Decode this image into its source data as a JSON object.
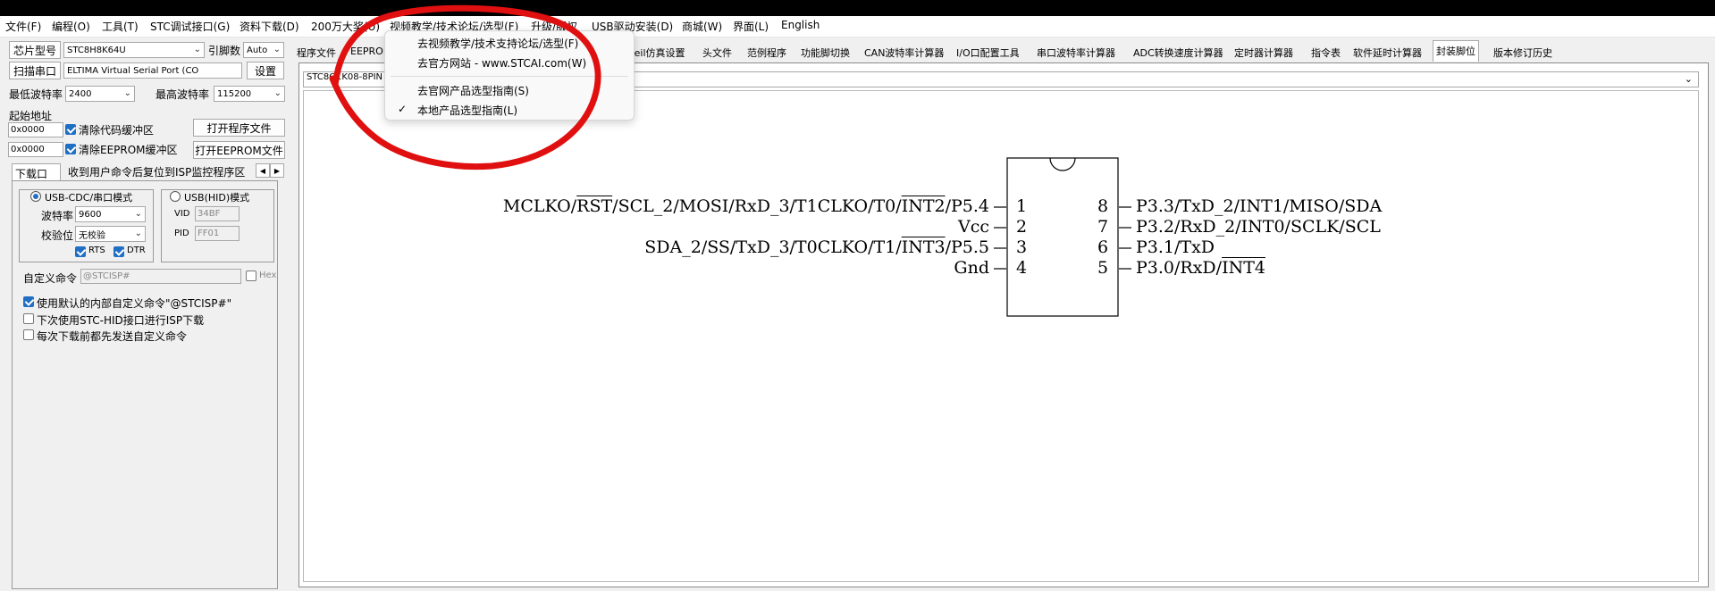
{
  "menubar": {
    "items": [
      "文件(F)",
      "编程(O)",
      "工具(T)",
      "STC调试接口(G)",
      "资料下载(D)",
      "200万大奖(U)",
      "视频教学/技术论坛/选型(F)",
      "升级/版权",
      "USB驱动安装(D)",
      "商城(W)",
      "界面(L)",
      "English"
    ]
  },
  "dropdown": {
    "items": [
      {
        "label": "去视频教学/技术支持论坛/选型(F)",
        "checked": false
      },
      {
        "label": "去官方网站 - www.STCAI.com(W)",
        "checked": false
      },
      {
        "label": "去官网产品选型指南(S)",
        "checked": false
      },
      {
        "label": "本地产品选型指南(L)",
        "checked": true
      }
    ],
    "check_glyph": "✓"
  },
  "left": {
    "chip_label": "芯片型号",
    "chip_value": "STC8H8K64U",
    "pins_label": "引脚数",
    "pins_value": "Auto",
    "scan_button": "扫描串口",
    "port_value": "ELTIMA Virtual Serial Port (CO",
    "settings_button": "设置",
    "min_baud_label": "最低波特率",
    "min_baud_value": "2400",
    "max_baud_label": "最高波特率",
    "max_baud_value": "115200",
    "start_addr_label": "起始地址",
    "addr1": "0x0000",
    "clear_code_label": "清除代码缓冲区",
    "open_prog_button": "打开程序文件",
    "addr2": "0x0000",
    "clear_eeprom_label": "清除EEPROM缓冲区",
    "open_eeprom_button": "打开EEPROM文件",
    "download_tab": "下载口令",
    "reset_tab": "收到用户命令后复位到ISP监控程序区",
    "usb_cdc_label": "USB-CDC/串口模式",
    "usb_hid_label": "USB(HID)模式",
    "baud_label": "波特率",
    "baud_value": "9600",
    "parity_label": "校验位",
    "parity_value": "无校验",
    "rts_label": "RTS",
    "dtr_label": "DTR",
    "vid_label": "VID",
    "vid_value": "34BF",
    "pid_label": "PID",
    "pid_value": "FF01",
    "custom_cmd_label": "自定义命令",
    "custom_cmd_value": "@STCISP#",
    "hex_label": "Hex",
    "opt1": "使用默认的内部自定义命令\"@STCISP#\"",
    "opt2": "下次使用STC-HID接口进行ISP下载",
    "opt3": "每次下载前都先发送自定义命令"
  },
  "tabs": [
    {
      "label": "程序文件",
      "active": false
    },
    {
      "label": "EEPROM",
      "active": false
    },
    {
      "label": "Keil仿真设置",
      "active": false
    },
    {
      "label": "头文件",
      "active": false
    },
    {
      "label": "范例程序",
      "active": false
    },
    {
      "label": "功能脚切换",
      "active": false
    },
    {
      "label": "CAN波特率计算器",
      "active": false
    },
    {
      "label": "I/O口配置工具",
      "active": false
    },
    {
      "label": "串口波特率计算器",
      "active": false
    },
    {
      "label": "ADC转换速度计算器",
      "active": false
    },
    {
      "label": "定时器计算器",
      "active": false
    },
    {
      "label": "指令表",
      "active": false
    },
    {
      "label": "软件延时计算器",
      "active": false
    },
    {
      "label": "封装脚位",
      "active": true
    },
    {
      "label": "版本修订历史",
      "active": false
    }
  ],
  "package": {
    "selected": "STC8G1K08-8PIN",
    "left_pins": [
      {
        "pre": "MCLKO/",
        "ov1": "RST",
        "mid": "/SCL_2/MOSI/RxD_3/T1CLKO/T0/",
        "ov2": "INT2",
        "post": "/P5.4",
        "num": "1"
      },
      {
        "pre": "Vcc",
        "ov1": "",
        "mid": "",
        "ov2": "",
        "post": "",
        "num": "2"
      },
      {
        "pre": "SDA_2/SS/TxD_3/T0CLKO/T1/",
        "ov1": "INT3",
        "mid": "",
        "ov2": "",
        "post": "/P5.5",
        "num": "3"
      },
      {
        "pre": "Gnd",
        "ov1": "",
        "mid": "",
        "ov2": "",
        "post": "",
        "num": "4"
      }
    ],
    "right_pins": [
      {
        "num": "8",
        "pre": "P3.3/TxD_2/INT1/MISO/SDA",
        "ov": ""
      },
      {
        "num": "7",
        "pre": "P3.2/RxD_2/INT0/SCLK/SCL",
        "ov": ""
      },
      {
        "num": "6",
        "pre": "P3.1/TxD",
        "ov": ""
      },
      {
        "num": "5",
        "pre": "P3.0/RxD/",
        "ov": "INT4"
      }
    ]
  }
}
